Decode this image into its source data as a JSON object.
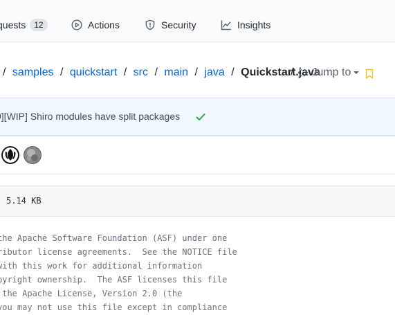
{
  "nav": {
    "pulls_label": "quests",
    "pulls_count": "12",
    "actions_label": "Actions",
    "security_label": "Security",
    "insights_label": "Insights"
  },
  "breadcrumb": {
    "lead_sep": "/",
    "items": [
      "samples",
      "quickstart",
      "src",
      "main",
      "java"
    ],
    "sep": "/",
    "file": "Quickstart.java",
    "jump_slash": "/",
    "jump_label": "Jump to"
  },
  "commit": {
    "message": "9][WIP] Shiro modules have split packages"
  },
  "file": {
    "size": "5.14 KB"
  },
  "code": {
    "lines": [
      "the Apache Software Foundation (ASF) under one",
      "ributor license agreements.  See the NOTICE file",
      "with this work for additional information",
      "pyright ownership.  The ASF licenses this file",
      " the Apache License, Version 2.0 (the",
      "you may not use this file except in compliance"
    ]
  },
  "colors": {
    "link": "#0366d6",
    "success": "#28a745",
    "bookmark": "#f9c513"
  }
}
